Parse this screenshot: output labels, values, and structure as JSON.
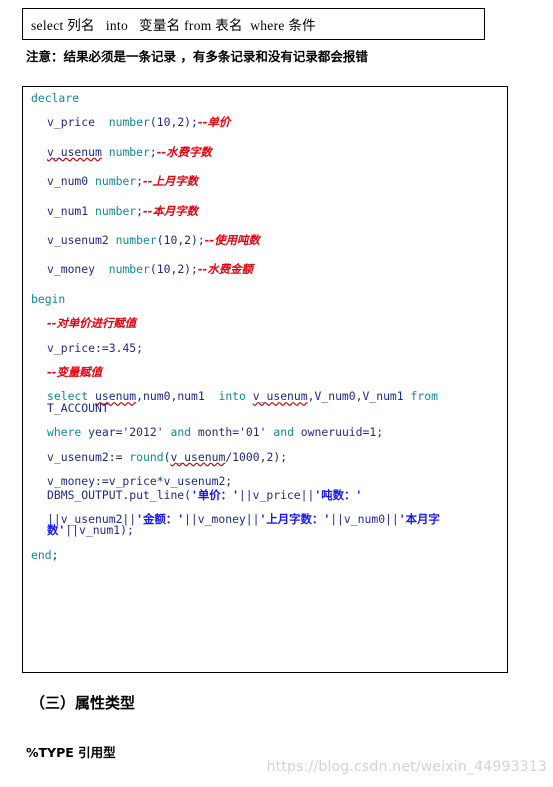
{
  "document": {
    "syntax_box": {
      "text": "select 列名   into   变量名 from 表名  where 条件"
    },
    "note": {
      "text": "注意：结果必须是一条记录 ，有多条记录和没有记录都会报错"
    },
    "code_block": {
      "language": "plsql",
      "lines": [
        {
          "indent": 0,
          "tokens": [
            {
              "t": "declare",
              "c": "kw"
            }
          ]
        },
        {
          "indent": 1,
          "tokens": [
            {
              "t": "v_price",
              "c": "var"
            },
            {
              "t": "  ",
              "c": "plain"
            },
            {
              "t": "number",
              "c": "kw"
            },
            {
              "t": "(10,2);",
              "c": "var"
            },
            {
              "t": "--单价",
              "c": "cmt"
            }
          ]
        },
        {
          "indent": 1,
          "tokens": [
            {
              "t": "v_usenum",
              "c": "var squig"
            },
            {
              "t": " ",
              "c": "plain"
            },
            {
              "t": "number",
              "c": "kw"
            },
            {
              "t": ";",
              "c": "var"
            },
            {
              "t": "--水费字数",
              "c": "cmt"
            }
          ]
        },
        {
          "indent": 1,
          "tokens": [
            {
              "t": "v_num0",
              "c": "var"
            },
            {
              "t": " ",
              "c": "plain"
            },
            {
              "t": "number",
              "c": "kw"
            },
            {
              "t": ";",
              "c": "var"
            },
            {
              "t": "--上月字数",
              "c": "cmt"
            }
          ]
        },
        {
          "indent": 1,
          "tokens": [
            {
              "t": "v_num1",
              "c": "var"
            },
            {
              "t": " ",
              "c": "plain"
            },
            {
              "t": "number",
              "c": "kw"
            },
            {
              "t": ";",
              "c": "var"
            },
            {
              "t": "--本月字数",
              "c": "cmt"
            }
          ]
        },
        {
          "indent": 1,
          "tokens": [
            {
              "t": "v_usenum2",
              "c": "var"
            },
            {
              "t": " ",
              "c": "plain"
            },
            {
              "t": "number",
              "c": "kw"
            },
            {
              "t": "(10,2);",
              "c": "var"
            },
            {
              "t": "--使用吨数",
              "c": "cmt"
            }
          ]
        },
        {
          "indent": 1,
          "tokens": [
            {
              "t": "v_money",
              "c": "var"
            },
            {
              "t": "  ",
              "c": "plain"
            },
            {
              "t": "number",
              "c": "kw"
            },
            {
              "t": "(10,2);",
              "c": "var"
            },
            {
              "t": "--水费金额",
              "c": "cmt"
            }
          ]
        },
        {
          "indent": 0,
          "tokens": [
            {
              "t": "begin",
              "c": "kw"
            }
          ]
        },
        {
          "indent": 1,
          "tokens": [
            {
              "t": "--对单价进行赋值",
              "c": "cmt"
            }
          ]
        },
        {
          "indent": 1,
          "tokens": [
            {
              "t": "v_price:=",
              "c": "var"
            },
            {
              "t": "3.45;",
              "c": "num"
            }
          ]
        },
        {
          "indent": 1,
          "tokens": [
            {
              "t": "--变量赋值",
              "c": "cmt"
            }
          ]
        },
        {
          "indent": 1,
          "tokens": [
            {
              "t": "select",
              "c": "kw"
            },
            {
              "t": " ",
              "c": "plain"
            },
            {
              "t": "usenum",
              "c": "var squig"
            },
            {
              "t": ",num0,num1",
              "c": "var"
            },
            {
              "t": "  ",
              "c": "plain"
            },
            {
              "t": "into",
              "c": "kw"
            },
            {
              "t": " ",
              "c": "plain"
            },
            {
              "t": "v_usenum",
              "c": "var squig"
            },
            {
              "t": ",V_num0,V_num1",
              "c": "var"
            },
            {
              "t": " ",
              "c": "plain"
            },
            {
              "t": "from",
              "c": "kw"
            },
            {
              "t": " ",
              "c": "plain"
            },
            {
              "t": "T_ACCOUNT",
              "c": "var"
            }
          ]
        },
        {
          "indent": 1,
          "tokens": [
            {
              "t": "where",
              "c": "kw"
            },
            {
              "t": " year=",
              "c": "var"
            },
            {
              "t": "'2012'",
              "c": "var"
            },
            {
              "t": " ",
              "c": "plain"
            },
            {
              "t": "and",
              "c": "kw"
            },
            {
              "t": " month=",
              "c": "var"
            },
            {
              "t": "'01'",
              "c": "var"
            },
            {
              "t": " ",
              "c": "plain"
            },
            {
              "t": "and",
              "c": "kw"
            },
            {
              "t": " owneruuid=1;",
              "c": "var"
            }
          ]
        },
        {
          "indent": 1,
          "tokens": [
            {
              "t": "v_usenum2:=",
              "c": "var"
            },
            {
              "t": " ",
              "c": "plain"
            },
            {
              "t": "round",
              "c": "kw"
            },
            {
              "t": "(",
              "c": "var"
            },
            {
              "t": "v_usenum",
              "c": "var squig"
            },
            {
              "t": "/1000,2);",
              "c": "var"
            }
          ]
        },
        {
          "indent": 1,
          "tokens": [
            {
              "t": "v_money:=v_price*v_usenum2;",
              "c": "var"
            }
          ]
        },
        {
          "indent": 1,
          "tokens": [
            {
              "t": "DBMS_OUTPUT.put_line(",
              "c": "var"
            },
            {
              "t": "'",
              "c": "str"
            },
            {
              "t": "单价：",
              "c": "strcn"
            },
            {
              "t": "'",
              "c": "str"
            },
            {
              "t": "||v_price||",
              "c": "var"
            },
            {
              "t": "'",
              "c": "str"
            },
            {
              "t": "吨数：",
              "c": "strcn"
            },
            {
              "t": "'",
              "c": "str"
            }
          ]
        },
        {
          "indent": 1,
          "tokens": [
            {
              "t": "||v_usenum2||",
              "c": "var"
            },
            {
              "t": "'",
              "c": "str"
            },
            {
              "t": "金额：",
              "c": "strcn"
            },
            {
              "t": "'",
              "c": "str"
            },
            {
              "t": "||v_money||",
              "c": "var"
            },
            {
              "t": "'",
              "c": "str"
            },
            {
              "t": "上月字数：",
              "c": "strcn"
            },
            {
              "t": "'",
              "c": "str"
            },
            {
              "t": "||v_num0||",
              "c": "var"
            },
            {
              "t": "'",
              "c": "str"
            },
            {
              "t": "本月字数",
              "c": "strcn"
            },
            {
              "t": "'",
              "c": "str"
            },
            {
              "t": "||v_num1);",
              "c": "var"
            }
          ]
        },
        {
          "indent": 0,
          "tokens": [
            {
              "t": "end",
              "c": "kw"
            },
            {
              "t": ";",
              "c": "var"
            }
          ]
        }
      ]
    },
    "section_heading": {
      "text": "（三）属性类型"
    },
    "body_text": {
      "text": "%TYPE 引用型"
    },
    "watermark": {
      "text": "https://blog.csdn.net/weixin_44993313"
    }
  },
  "colors": {
    "keyword": "#0d8a96",
    "identifier": "#1d2a8c",
    "comment": "#e8000d",
    "string": "#1414ff",
    "border": "#000000",
    "watermark": "#d2d2d2",
    "background": "#ffffff"
  }
}
